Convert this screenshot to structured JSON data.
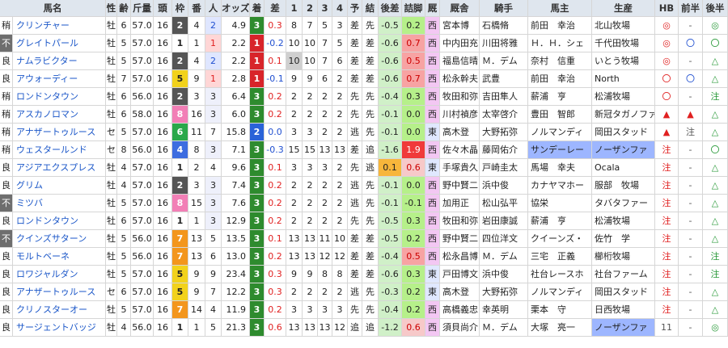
{
  "headers": [
    "馬名",
    "性",
    "齢",
    "斤量",
    "頭",
    "枠",
    "番",
    "人",
    "オッズ",
    "着",
    "差",
    "1",
    "2",
    "3",
    "4",
    "予",
    "結",
    "後差",
    "詰脚",
    "厩",
    "厩舎",
    "騎手",
    "馬主",
    "生産",
    "HB",
    "前半",
    "後半"
  ],
  "colors": {
    "header_bg": "#dfe6ee",
    "waku": {
      "1": "#ffffff",
      "2": "#555555",
      "3": "#e33b3b",
      "4": "#3d6de0",
      "5": "#f2d21b",
      "6": "#2aa84a",
      "7": "#f3961d",
      "8": "#f27fb6"
    },
    "pop1": "#ffd6d6",
    "pop2": "#dfe6ff",
    "pop3": "#e8ffe0",
    "finish_bg": "#2e8b2e",
    "sa_bg": "#d0f0c8",
    "tsume_green": "#b6f08a",
    "tsume_red": "#f03a3a",
    "tsume_orange": "#f7b63b",
    "tsume_pink": "#f7c9c9",
    "kyusha_w": "#f3c7f3",
    "kyusha_e": "#e0e8ff",
    "banner": "#9db6ff"
  },
  "rows": [
    {
      "cond": "稍",
      "name": "クリンチャー",
      "sex": "牡",
      "age": "6",
      "kin": "57.0",
      "tou": "16",
      "waku": "2",
      "ban": "4",
      "nin": "2",
      "odds": "4.9",
      "chaku": "3",
      "sa": "0.3",
      "c1": "8",
      "c2": "7",
      "c3": "5",
      "c4": "3",
      "yo": "差",
      "ke": "先",
      "kosa": "-0.5",
      "tsume": "0.2",
      "tsumeColor": "green",
      "kyu": "西",
      "kyusha": "宮本博",
      "jockey": "石橋脩",
      "owner": "前田　幸治",
      "breeder": "北山牧場",
      "hb": "◎",
      "zen": "-",
      "kou": "◎"
    },
    {
      "cond": "不",
      "name": "グレイトパール",
      "sex": "牡",
      "age": "5",
      "kin": "57.0",
      "tou": "16",
      "waku": "1",
      "ban": "1",
      "nin": "1",
      "odds": "2.2",
      "chaku": "1",
      "sa": "-0.2",
      "c1": "10",
      "c2": "10",
      "c3": "7",
      "c4": "5",
      "yo": "差",
      "ke": "差",
      "kosa": "-0.6",
      "tsume": "0.7",
      "tsumeColor": "red",
      "kyu": "西",
      "kyusha": "中内田充",
      "jockey": "川田将雅",
      "owner": "Ｈ．Ｈ．シェ",
      "breeder": "千代田牧場",
      "hb": "◎",
      "zen": "〇",
      "kou": "〇"
    },
    {
      "cond": "良",
      "name": "ナムラビクター",
      "sex": "牡",
      "age": "5",
      "kin": "57.0",
      "tou": "16",
      "waku": "2",
      "ban": "4",
      "nin": "2",
      "odds": "2.2",
      "chaku": "1",
      "sa": "0.1",
      "c1": "10",
      "c2": "10",
      "c3": "7",
      "c4": "6",
      "yo": "差",
      "ke": "差",
      "kosa": "-0.6",
      "tsume": "0.5",
      "tsumeColor": "red",
      "kyu": "西",
      "kyusha": "福島信晴",
      "jockey": "Ｍ．デム",
      "owner": "奈村　信重",
      "breeder": "いとう牧場",
      "hb": "◎",
      "zen": "-",
      "kou": "△"
    },
    {
      "cond": "良",
      "name": "アウォーディー",
      "sex": "牡",
      "age": "7",
      "kin": "57.0",
      "tou": "16",
      "waku": "5",
      "ban": "9",
      "nin": "1",
      "odds": "2.8",
      "chaku": "1",
      "sa": "-0.1",
      "c1": "9",
      "c2": "9",
      "c3": "6",
      "c4": "2",
      "yo": "差",
      "ke": "差",
      "kosa": "-0.6",
      "tsume": "0.7",
      "tsumeColor": "red",
      "kyu": "西",
      "kyusha": "松永幹夫",
      "jockey": "武豊",
      "owner": "前田　幸治",
      "breeder": "North",
      "hb": "〇",
      "zen": "〇",
      "kou": "△"
    },
    {
      "cond": "稍",
      "name": "ロンドンタウン",
      "sex": "牡",
      "age": "6",
      "kin": "56.0",
      "tou": "16",
      "waku": "2",
      "ban": "3",
      "nin": "3",
      "odds": "6.4",
      "chaku": "3",
      "sa": "0.2",
      "c1": "2",
      "c2": "2",
      "c3": "2",
      "c4": "2",
      "yo": "先",
      "ke": "先",
      "kosa": "-0.4",
      "tsume": "0.3",
      "tsumeColor": "green",
      "kyu": "西",
      "kyusha": "牧田和弥",
      "jockey": "吉田隼人",
      "owner": "薪浦　亨",
      "breeder": "松浦牧場",
      "hb": "〇",
      "zen": "-",
      "kou": "注"
    },
    {
      "cond": "稍",
      "name": "アスカノロマン",
      "sex": "牡",
      "age": "6",
      "kin": "58.0",
      "tou": "16",
      "waku": "8",
      "ban": "16",
      "nin": "3",
      "odds": "6.0",
      "chaku": "3",
      "sa": "0.2",
      "c1": "2",
      "c2": "2",
      "c3": "2",
      "c4": "2",
      "yo": "先",
      "ke": "先",
      "kosa": "-0.1",
      "tsume": "0.0",
      "tsumeColor": "green",
      "kyu": "西",
      "kyusha": "川村禎彦",
      "jockey": "太宰啓介",
      "owner": "豊田　智郎",
      "breeder": "新冠タガノファ",
      "hb": "▲",
      "zen": "▲",
      "kou": "△"
    },
    {
      "cond": "稍",
      "name": "アナザートゥルース",
      "sex": "セ",
      "age": "5",
      "kin": "57.0",
      "tou": "16",
      "waku": "6",
      "ban": "11",
      "nin": "7",
      "odds": "15.8",
      "chaku": "2",
      "sa": "0.0",
      "c1": "3",
      "c2": "3",
      "c3": "2",
      "c4": "2",
      "yo": "逃",
      "ke": "先",
      "kosa": "-0.1",
      "tsume": "0.0",
      "tsumeColor": "green",
      "kyu": "東",
      "kyusha": "高木登",
      "jockey": "大野拓弥",
      "owner": "ノルマンディ",
      "breeder": "岡田スタッド",
      "hb": "▲",
      "zen": "注",
      "kou": "△"
    },
    {
      "cond": "稍",
      "name": "ウェスタールンド",
      "sex": "セ",
      "age": "8",
      "kin": "56.0",
      "tou": "16",
      "waku": "4",
      "ban": "8",
      "nin": "3",
      "odds": "7.1",
      "chaku": "3",
      "sa": "-0.3",
      "c1": "15",
      "c2": "15",
      "c3": "13",
      "c4": "13",
      "yo": "差",
      "ke": "追",
      "kosa": "-1.6",
      "tsume": "1.9",
      "tsumeColor": "redfull",
      "kyu": "西",
      "kyusha": "佐々木晶",
      "jockey": "藤岡佑介",
      "owner": "サンデーレー",
      "breeder": "ノーザンファ",
      "hb": "注",
      "zen": "-",
      "kou": "〇"
    },
    {
      "cond": "良",
      "name": "アジアエクスプレス",
      "sex": "牡",
      "age": "4",
      "kin": "57.0",
      "tou": "16",
      "waku": "1",
      "ban": "2",
      "nin": "4",
      "odds": "9.6",
      "chaku": "3",
      "sa": "0.1",
      "c1": "3",
      "c2": "3",
      "c3": "3",
      "c4": "2",
      "yo": "先",
      "ke": "逃",
      "kosa": "0.1",
      "tsume": "0.6",
      "tsumeColor": "pink",
      "kyu": "東",
      "kyusha": "手塚貴久",
      "jockey": "戸崎圭太",
      "owner": "馬場　幸夫",
      "breeder": "Ocala",
      "hb": "注",
      "zen": "-",
      "kou": "△"
    },
    {
      "cond": "良",
      "name": "グリム",
      "sex": "牡",
      "age": "4",
      "kin": "57.0",
      "tou": "16",
      "waku": "2",
      "ban": "3",
      "nin": "3",
      "odds": "7.4",
      "chaku": "3",
      "sa": "0.2",
      "c1": "2",
      "c2": "2",
      "c3": "2",
      "c4": "2",
      "yo": "逃",
      "ke": "先",
      "kosa": "-0.1",
      "tsume": "0.0",
      "tsumeColor": "green",
      "kyu": "西",
      "kyusha": "野中賢二",
      "jockey": "浜中俊",
      "owner": "カナヤマホー",
      "breeder": "服部　牧場",
      "hb": "注",
      "zen": "-",
      "kou": "△"
    },
    {
      "cond": "不",
      "name": "ミツバ",
      "sex": "牡",
      "age": "5",
      "kin": "57.0",
      "tou": "16",
      "waku": "8",
      "ban": "15",
      "nin": "3",
      "odds": "7.6",
      "chaku": "3",
      "sa": "0.2",
      "c1": "2",
      "c2": "2",
      "c3": "2",
      "c4": "2",
      "yo": "逃",
      "ke": "先",
      "kosa": "-0.1",
      "tsume": "-0.1",
      "tsumeColor": "green",
      "kyu": "西",
      "kyusha": "加用正",
      "jockey": "松山弘平",
      "owner": "協栄",
      "breeder": "タバタファー",
      "hb": "注",
      "zen": "-",
      "kou": "△"
    },
    {
      "cond": "良",
      "name": "ロンドンタウン",
      "sex": "牡",
      "age": "6",
      "kin": "57.0",
      "tou": "16",
      "waku": "1",
      "ban": "1",
      "nin": "3",
      "odds": "12.9",
      "chaku": "3",
      "sa": "0.2",
      "c1": "2",
      "c2": "2",
      "c3": "2",
      "c4": "2",
      "yo": "先",
      "ke": "先",
      "kosa": "-0.5",
      "tsume": "0.3",
      "tsumeColor": "green",
      "kyu": "西",
      "kyusha": "牧田和弥",
      "jockey": "岩田康誠",
      "owner": "薪浦　亨",
      "breeder": "松浦牧場",
      "hb": "注",
      "zen": "-",
      "kou": "△"
    },
    {
      "cond": "不",
      "name": "クインズサターン",
      "sex": "牡",
      "age": "5",
      "kin": "56.0",
      "tou": "16",
      "waku": "7",
      "ban": "13",
      "nin": "5",
      "odds": "13.5",
      "chaku": "3",
      "sa": "0.1",
      "c1": "13",
      "c2": "13",
      "c3": "11",
      "c4": "10",
      "yo": "差",
      "ke": "差",
      "kosa": "-0.5",
      "tsume": "0.2",
      "tsumeColor": "green",
      "kyu": "西",
      "kyusha": "野中賢二",
      "jockey": "四位洋文",
      "owner": "クイーンズ・",
      "breeder": "佐竹　学",
      "hb": "注",
      "zen": "-",
      "kou": "△"
    },
    {
      "cond": "良",
      "name": "モルトベーネ",
      "sex": "牡",
      "age": "5",
      "kin": "56.0",
      "tou": "16",
      "waku": "7",
      "ban": "13",
      "nin": "6",
      "odds": "13.0",
      "chaku": "3",
      "sa": "0.2",
      "c1": "13",
      "c2": "13",
      "c3": "12",
      "c4": "12",
      "yo": "差",
      "ke": "差",
      "kosa": "-0.4",
      "tsume": "0.5",
      "tsumeColor": "red",
      "kyu": "西",
      "kyusha": "松永昌博",
      "jockey": "Ｍ．デム",
      "owner": "三宅　正義",
      "breeder": "櫛桁牧場",
      "hb": "注",
      "zen": "-",
      "kou": "注"
    },
    {
      "cond": "良",
      "name": "ロワジャルダン",
      "sex": "牡",
      "age": "5",
      "kin": "57.0",
      "tou": "16",
      "waku": "5",
      "ban": "9",
      "nin": "9",
      "odds": "23.4",
      "chaku": "3",
      "sa": "0.3",
      "c1": "9",
      "c2": "9",
      "c3": "8",
      "c4": "8",
      "yo": "差",
      "ke": "差",
      "kosa": "-0.6",
      "tsume": "0.3",
      "tsumeColor": "green",
      "kyu": "東",
      "kyusha": "戸田博文",
      "jockey": "浜中俊",
      "owner": "社台レースホ",
      "breeder": "社台ファーム",
      "hb": "注",
      "zen": "-",
      "kou": "注"
    },
    {
      "cond": "良",
      "name": "アナザートゥルース",
      "sex": "セ",
      "age": "6",
      "kin": "57.0",
      "tou": "16",
      "waku": "5",
      "ban": "9",
      "nin": "7",
      "odds": "12.2",
      "chaku": "3",
      "sa": "0.3",
      "c1": "2",
      "c2": "2",
      "c3": "2",
      "c4": "2",
      "yo": "逃",
      "ke": "先",
      "kosa": "-0.3",
      "tsume": "0.2",
      "tsumeColor": "green",
      "kyu": "東",
      "kyusha": "高木登",
      "jockey": "大野拓弥",
      "owner": "ノルマンディ",
      "breeder": "岡田スタッド",
      "hb": "注",
      "zen": "-",
      "kou": "△"
    },
    {
      "cond": "良",
      "name": "クリノスターオー",
      "sex": "牡",
      "age": "5",
      "kin": "57.0",
      "tou": "16",
      "waku": "7",
      "ban": "14",
      "nin": "4",
      "odds": "11.9",
      "chaku": "3",
      "sa": "0.2",
      "c1": "3",
      "c2": "3",
      "c3": "3",
      "c4": "3",
      "yo": "先",
      "ke": "先",
      "kosa": "-0.4",
      "tsume": "0.2",
      "tsumeColor": "green",
      "kyu": "西",
      "kyusha": "高橋義忠",
      "jockey": "幸英明",
      "owner": "栗本　守",
      "breeder": "日西牧場",
      "hb": "注",
      "zen": "-",
      "kou": "△"
    },
    {
      "cond": "良",
      "name": "サージェントバッジ",
      "sex": "牡",
      "age": "4",
      "kin": "56.0",
      "tou": "16",
      "waku": "1",
      "ban": "1",
      "nin": "5",
      "odds": "21.3",
      "chaku": "3",
      "sa": "0.6",
      "c1": "13",
      "c2": "13",
      "c3": "13",
      "c4": "12",
      "yo": "追",
      "ke": "追",
      "kosa": "-1.2",
      "tsume": "0.6",
      "tsumeColor": "pink",
      "kyu": "西",
      "kyusha": "須貝尚介",
      "jockey": "Ｍ．デム",
      "owner": "大塚　亮一",
      "breeder": "ノーザンファ",
      "hb": "11",
      "zen": "-",
      "kou": "◎"
    }
  ]
}
